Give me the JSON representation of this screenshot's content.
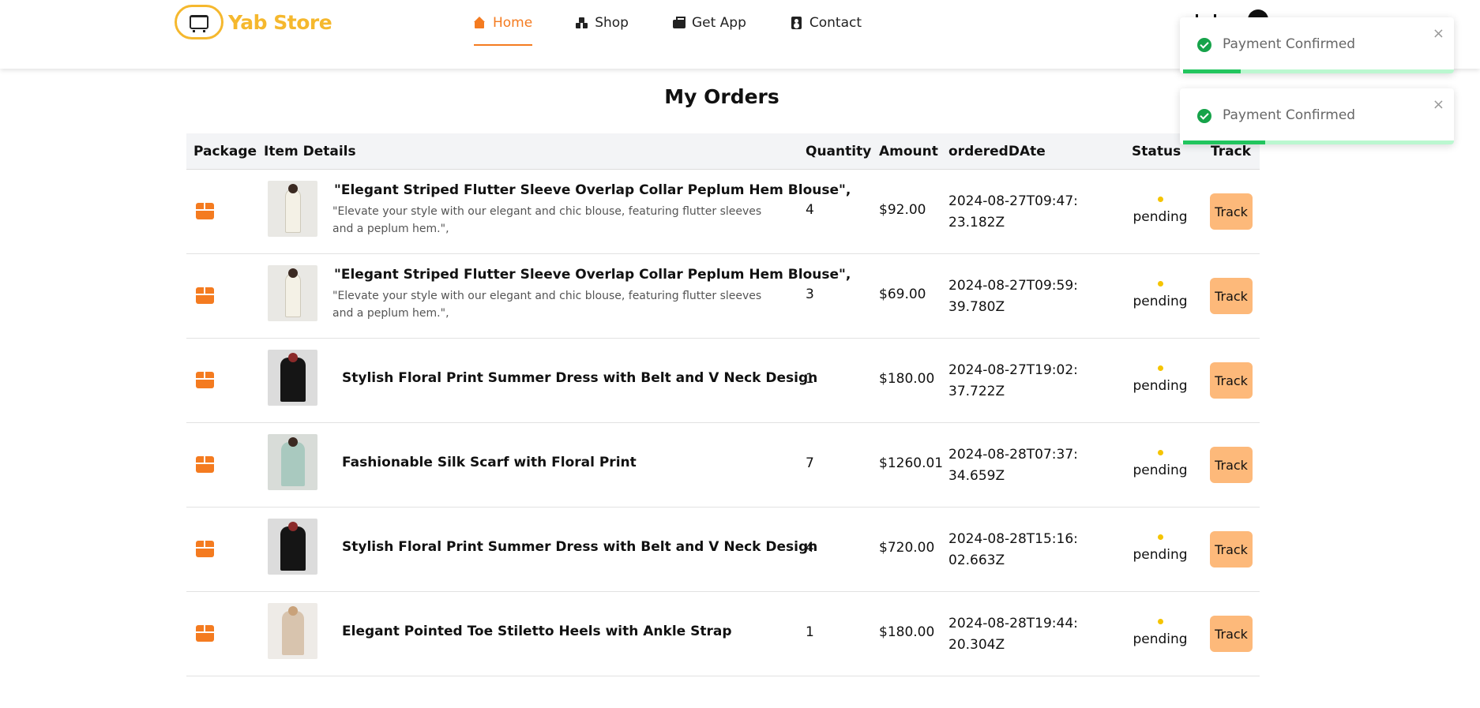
{
  "header": {
    "logo_text": "Yab Store",
    "nav": [
      {
        "label": "Home",
        "icon": "home-icon",
        "active": true
      },
      {
        "label": "Shop",
        "icon": "shapes-icon",
        "active": false
      },
      {
        "label": "Get App",
        "icon": "app-icon",
        "active": false
      },
      {
        "label": "Contact",
        "icon": "contact-icon",
        "active": false
      }
    ],
    "cart_icon": "cart-icon",
    "user_icon": "user-icon"
  },
  "page": {
    "title": "My Orders"
  },
  "table": {
    "columns": [
      "Package",
      "Item Details",
      "Quantity",
      "Amount",
      "orderedDAte",
      "Status",
      "Track"
    ],
    "rows": [
      {
        "image": "blouse",
        "title": "\"Elegant Striped Flutter Sleeve Overlap Collar Peplum Hem Blouse\",",
        "description": "\"Elevate your style with our elegant and chic blouse, featuring flutter sleeves and a peplum hem.\",",
        "quantity": "4",
        "amount": "$92.00",
        "ordered_date": "2024-08-27T09:47:23.182Z",
        "status": "pending",
        "track_label": "Track"
      },
      {
        "image": "blouse",
        "title": "\"Elegant Striped Flutter Sleeve Overlap Collar Peplum Hem Blouse\",",
        "description": "\"Elevate your style with our elegant and chic blouse, featuring flutter sleeves and a peplum hem.\",",
        "quantity": "3",
        "amount": "$69.00",
        "ordered_date": "2024-08-27T09:59:39.780Z",
        "status": "pending",
        "track_label": "Track"
      },
      {
        "image": "dress",
        "title": "Stylish Floral Print Summer Dress with Belt and V Neck Design",
        "description": "",
        "quantity": "1",
        "amount": "$180.00",
        "ordered_date": "2024-08-27T19:02:37.722Z",
        "status": "pending",
        "track_label": "Track"
      },
      {
        "image": "scarf",
        "title": "Fashionable Silk Scarf with Floral Print",
        "description": "",
        "quantity": "7",
        "amount": "$1260.01",
        "ordered_date": "2024-08-28T07:37:34.659Z",
        "status": "pending",
        "track_label": "Track"
      },
      {
        "image": "dress",
        "title": "Stylish Floral Print Summer Dress with Belt and V Neck Design",
        "description": "",
        "quantity": "4",
        "amount": "$720.00",
        "ordered_date": "2024-08-28T15:16:02.663Z",
        "status": "pending",
        "track_label": "Track"
      },
      {
        "image": "heels",
        "title": "Elegant Pointed Toe Stiletto Heels with Ankle Strap",
        "description": "",
        "quantity": "1",
        "amount": "$180.00",
        "ordered_date": "2024-08-28T19:44:20.304Z",
        "status": "pending",
        "track_label": "Track"
      }
    ]
  },
  "toasts": [
    {
      "message": "Payment Confirmed",
      "close": "×",
      "progress": 0.21
    },
    {
      "message": "Payment Confirmed",
      "close": "×",
      "progress": 0.3
    }
  ],
  "colors": {
    "brand": "#f5b82e",
    "accent": "#f47b20",
    "track_button": "#fdb97a",
    "pending_dot": "#f5c400",
    "success": "#22c55e"
  }
}
